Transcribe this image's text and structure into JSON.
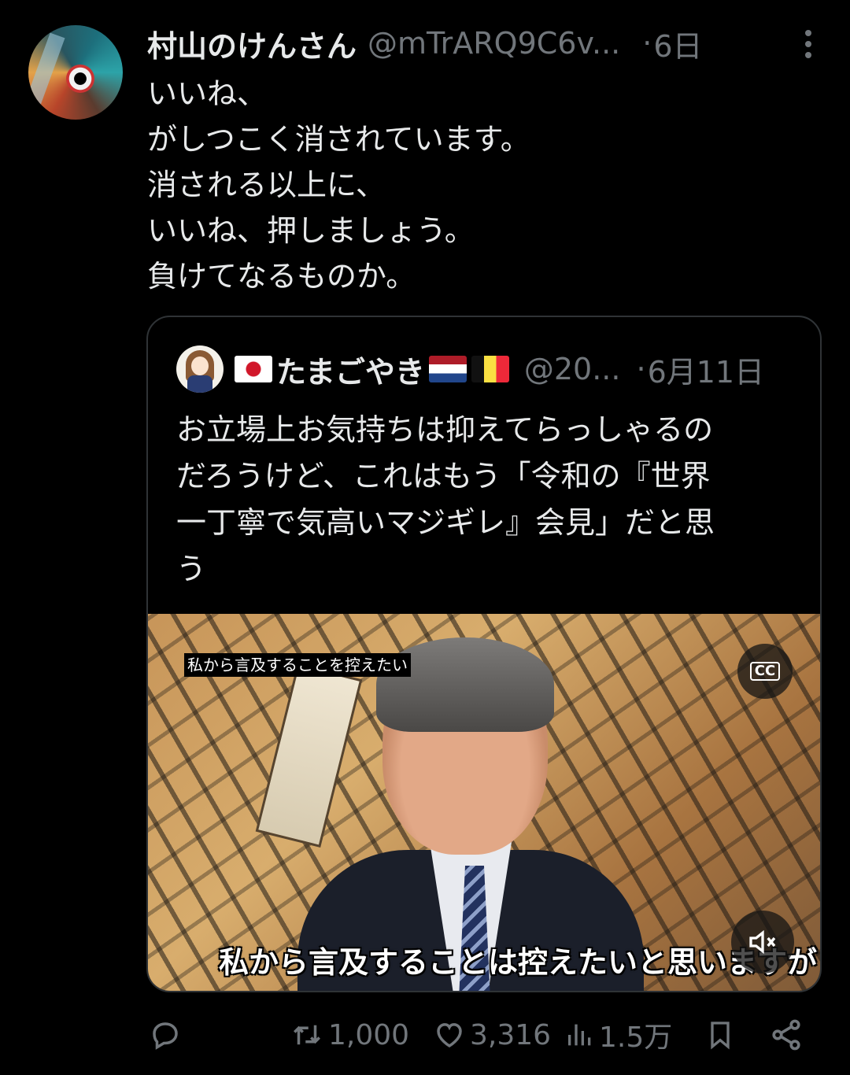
{
  "post": {
    "author_name": "村山のけんさん",
    "author_handle": "@mTrARQ9C6v...",
    "separator": "·",
    "time": "6日",
    "body_lines": [
      "いいね、",
      "がしつこく消されています。",
      "消される以上に、",
      "いいね、押しましょう。",
      "負けてなるものか。"
    ]
  },
  "quote": {
    "author_name": "たまごやき",
    "author_handle": "@20...",
    "separator": "·",
    "time": "6月11日",
    "body_lines": [
      "お立場上お気持ちは抑えてらっしゃるの",
      "だろうけど、これはもう「令和の『世界",
      "一丁寧で気高いマジギレ』会見」だと思",
      "う"
    ],
    "flags": [
      "japan-flag",
      "netherlands-flag",
      "belgium-flag"
    ],
    "video": {
      "caption_top": "私から言及することを控えたい",
      "subtitle": "私から言及することは控えたいと思いますが",
      "cc_label": "CC"
    }
  },
  "actions": {
    "reply": {
      "icon": "reply-icon"
    },
    "retweet": {
      "icon": "retweet-icon",
      "count": "1,000"
    },
    "like": {
      "icon": "heart-icon",
      "count": "3,316"
    },
    "views": {
      "icon": "views-icon",
      "count": "1.5万"
    },
    "bookmark": {
      "icon": "bookmark-icon"
    },
    "share": {
      "icon": "share-icon"
    }
  },
  "colors": {
    "background": "#000000",
    "text": "#e7e9ea",
    "secondary": "#71767b",
    "border": "#2f3336"
  }
}
